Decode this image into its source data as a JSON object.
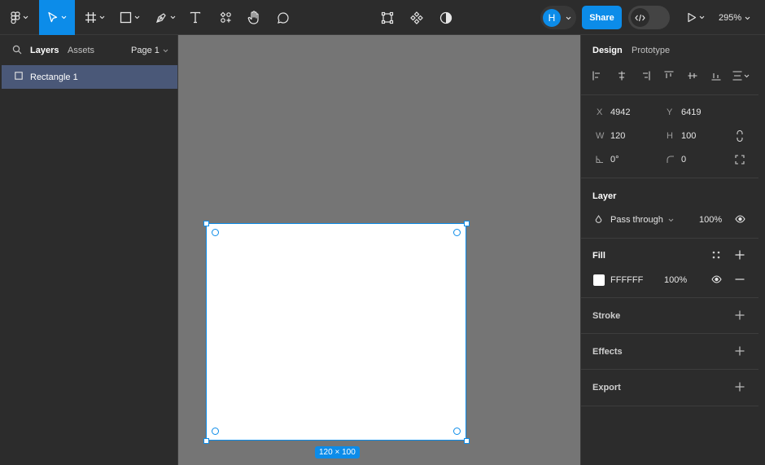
{
  "toolbar": {
    "share_label": "Share",
    "avatar_initial": "H",
    "zoom_label": "295%"
  },
  "left_panel": {
    "tabs": [
      {
        "label": "Layers"
      },
      {
        "label": "Assets"
      }
    ],
    "page_selector": "Page 1",
    "layers": [
      {
        "label": "Rectangle 1"
      }
    ]
  },
  "canvas": {
    "size_badge": "120 × 100"
  },
  "right_panel": {
    "tabs": [
      {
        "label": "Design"
      },
      {
        "label": "Prototype"
      }
    ],
    "position": {
      "x_label": "X",
      "x_value": "4942",
      "y_label": "Y",
      "y_value": "6419",
      "w_label": "W",
      "w_value": "120",
      "h_label": "H",
      "h_value": "100",
      "rotation_value": "0°",
      "radius_value": "0"
    },
    "layer": {
      "title": "Layer",
      "blend_mode": "Pass through",
      "opacity": "100%"
    },
    "fill": {
      "title": "Fill",
      "color_hex": "FFFFFF",
      "opacity": "100%",
      "swatch_color": "#FFFFFF"
    },
    "stroke": {
      "title": "Stroke"
    },
    "effects": {
      "title": "Effects"
    },
    "export": {
      "title": "Export"
    }
  },
  "colors": {
    "accent": "#0c8ce9",
    "panel_bg": "#2c2c2c",
    "canvas_bg": "#757575",
    "selection_row": "#4a5878"
  }
}
